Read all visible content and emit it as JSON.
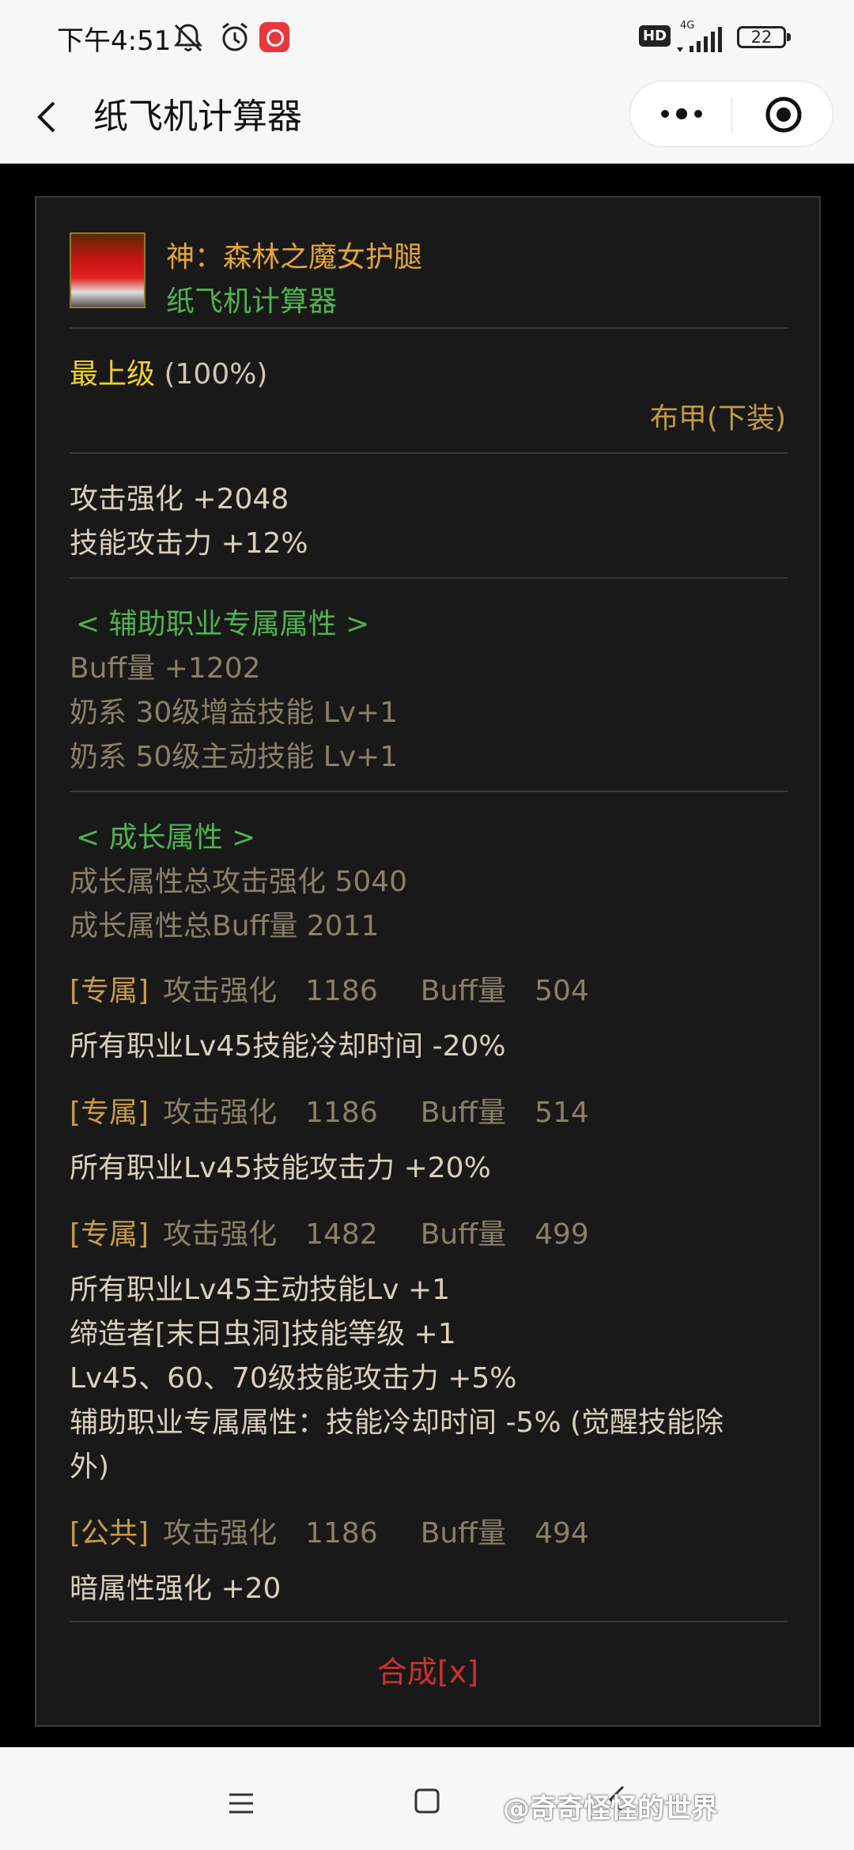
{
  "status_bar": {
    "time": "下午4:51",
    "network": "4G",
    "hd": "HD",
    "battery": "22"
  },
  "nav": {
    "title": "纸飞机计算器",
    "back_icon": "chevron-left-icon",
    "more_icon": "more-dots-icon",
    "target_icon": "record-target-icon"
  },
  "item": {
    "name": "神：森林之魔女护腿",
    "subtitle": "纸飞机计算器",
    "grade_label": "最上级",
    "grade_pct": "(100%)",
    "type": "布甲(下装)",
    "base_stats": [
      "攻击强化 +2048",
      "技能攻击力 +12%"
    ]
  },
  "support": {
    "header": "< 辅助职业专属属性 >",
    "lines": [
      "Buff量 +1202",
      "奶系 30级增益技能 Lv+1",
      "奶系 50级主动技能 Lv+1"
    ]
  },
  "growth": {
    "header": "< 成长属性 >",
    "lines": [
      "成长属性总攻击强化 5040",
      "成长属性总Buff量 2011"
    ],
    "entries": [
      {
        "tag": "[专属]",
        "atk_label": "攻击强化",
        "atk": "1186",
        "buff_label": "Buff量",
        "buff": "504",
        "effects": [
          "所有职业Lv45技能冷却时间 -20%"
        ]
      },
      {
        "tag": "[专属]",
        "atk_label": "攻击强化",
        "atk": "1186",
        "buff_label": "Buff量",
        "buff": "514",
        "effects": [
          "所有职业Lv45技能攻击力 +20%"
        ]
      },
      {
        "tag": "[专属]",
        "atk_label": "攻击强化",
        "atk": "1482",
        "buff_label": "Buff量",
        "buff": "499",
        "effects": [
          "所有职业Lv45主动技能Lv +1",
          "缔造者[末日虫洞]技能等级 +1",
          "Lv45、60、70级技能攻击力 +5%",
          "辅助职业专属属性：技能冷却时间 -5% (觉醒技能除",
          "外)"
        ]
      },
      {
        "tag": "[公共]",
        "atk_label": "攻击强化",
        "atk": "1186",
        "buff_label": "Buff量",
        "buff": "494",
        "effects": [
          "暗属性强化 +20"
        ]
      }
    ]
  },
  "craft_label": "合成[x]",
  "watermark": "@奇奇怪怪的世界",
  "colors": {
    "gold": "#e3a537",
    "green": "#4fb34f",
    "yellow": "#f0d22a",
    "grey": "#8b8068",
    "red": "#cc3131"
  }
}
